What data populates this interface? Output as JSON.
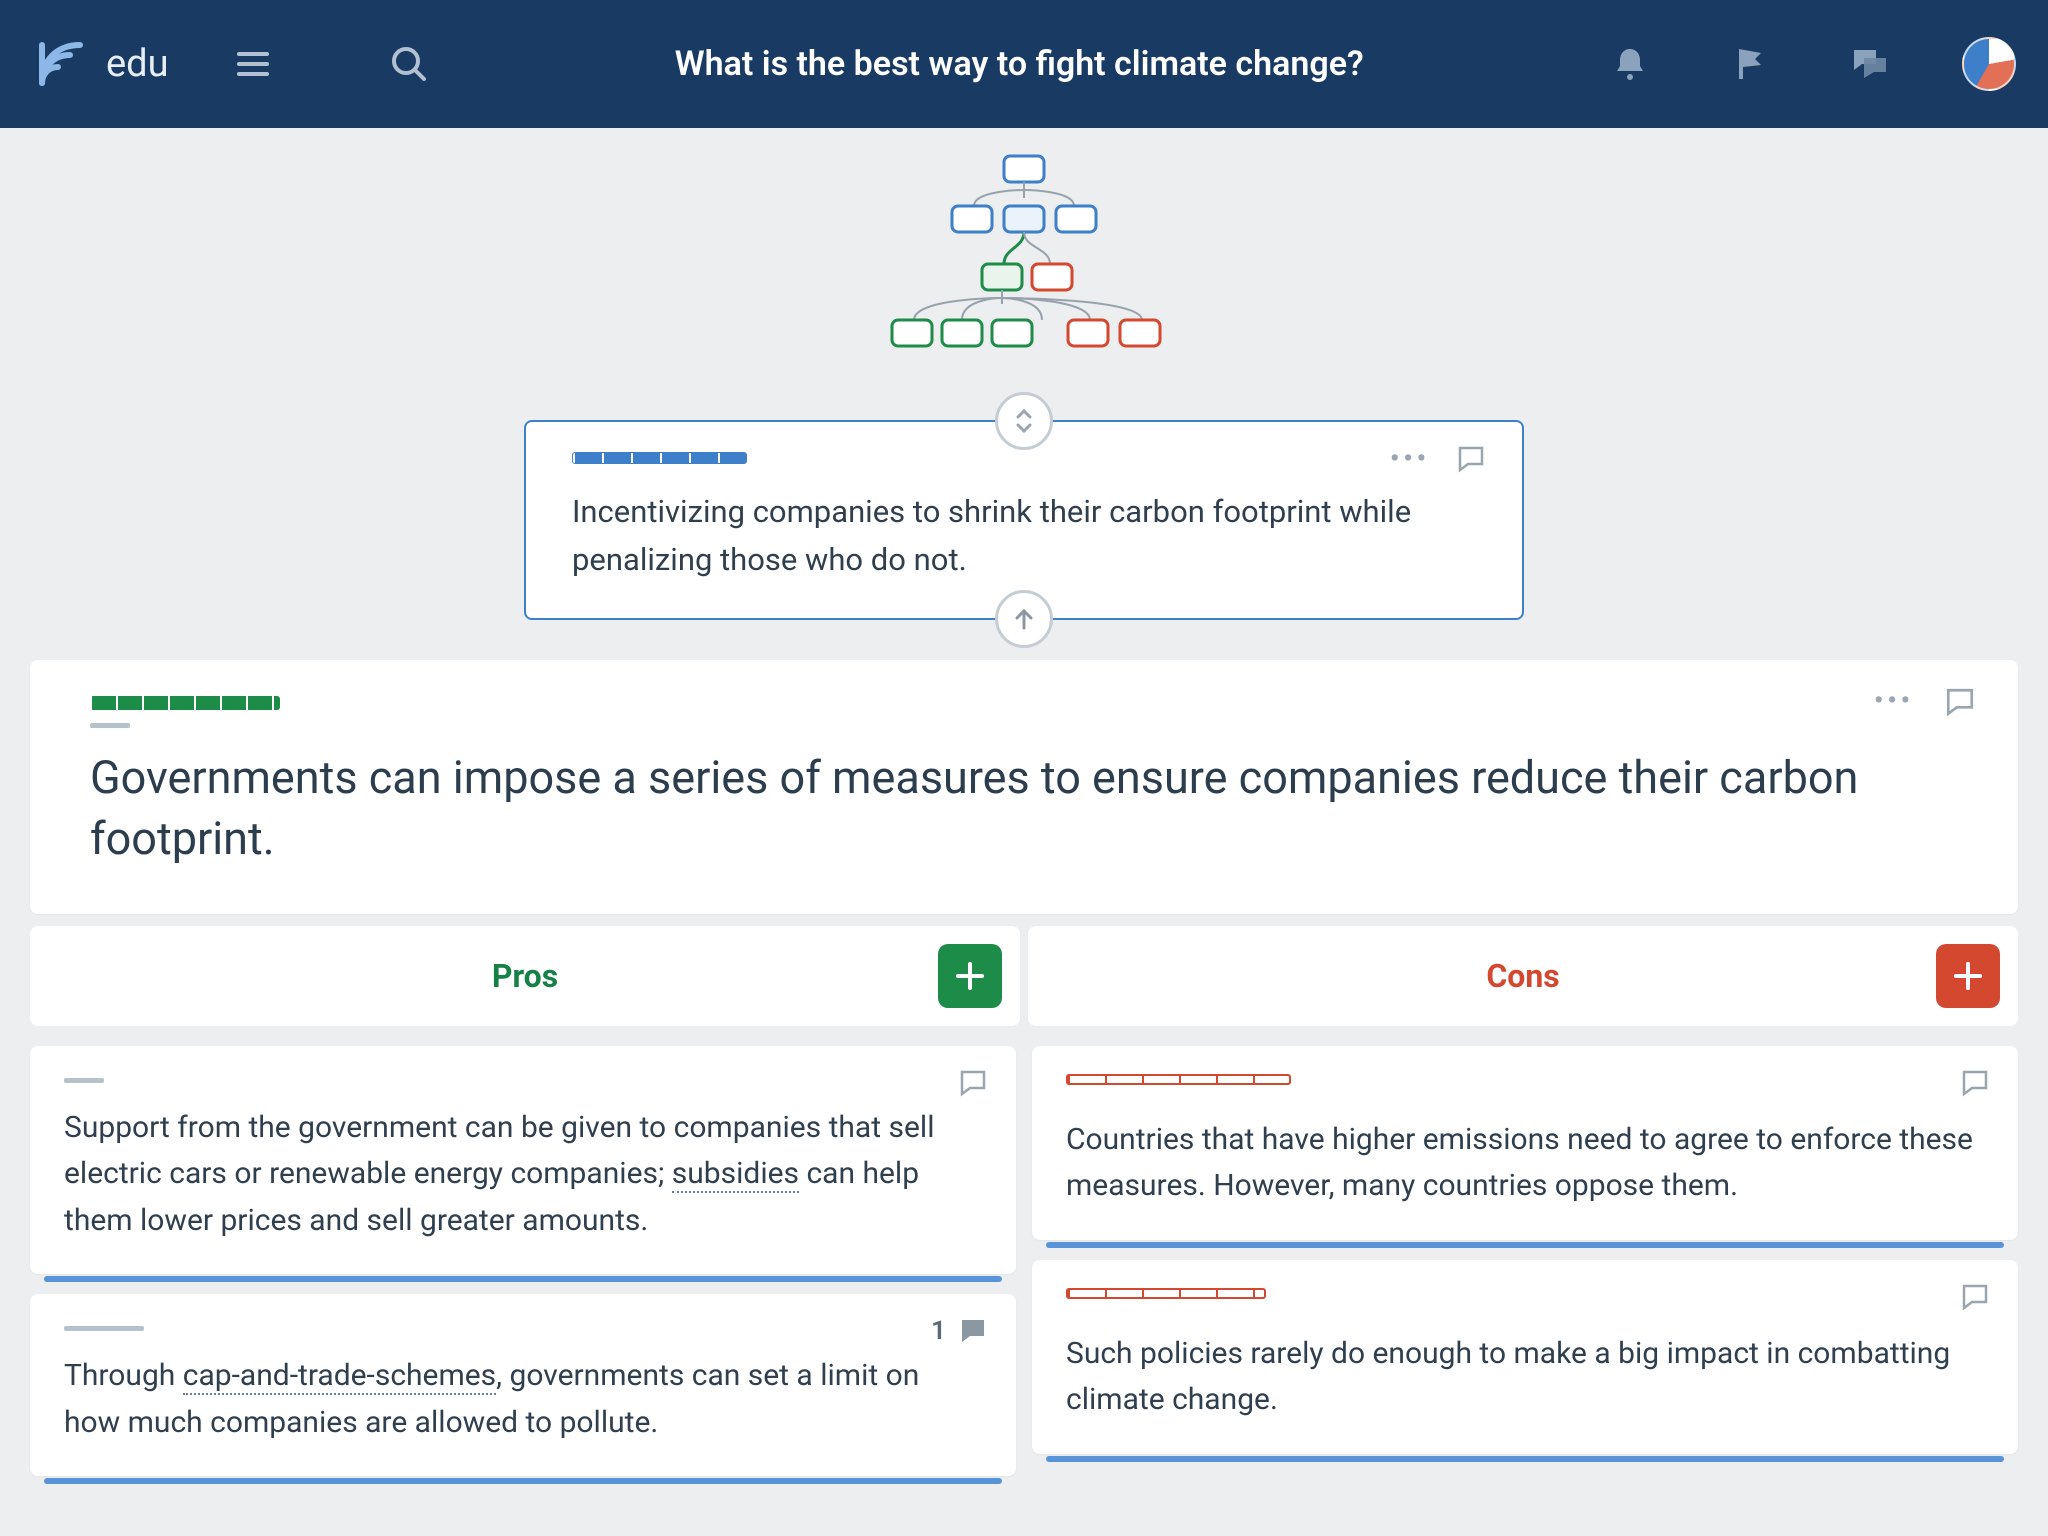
{
  "brand": "edu",
  "header": {
    "title": "What is the best way to fight climate change?"
  },
  "parent_claim": {
    "text": "Incentivizing companies to shrink their carbon footprint while penalizing those who do not."
  },
  "main_claim": {
    "text": "Governments can impose a series of measures to ensure companies reduce their carbon footprint."
  },
  "columns": {
    "pros_label": "Pros",
    "cons_label": "Cons"
  },
  "pros": [
    {
      "text_pre": "Support from the government can be given to companies that sell electric cars or renewable energy companies; ",
      "underlined": "subsidies",
      "text_post": " can help them lower prices and sell greater amounts."
    },
    {
      "text_pre": "Through ",
      "underlined": "cap-and-trade-schemes",
      "text_post": ", governments can set a limit on how much companies are allowed to pollute.",
      "comment_count": "1"
    }
  ],
  "cons": [
    {
      "text": "Countries that have higher emissions need to agree to enforce these measures. However, many countries oppose them."
    },
    {
      "text": "Such policies rarely do enough to make a big impact in combatting climate change."
    }
  ]
}
